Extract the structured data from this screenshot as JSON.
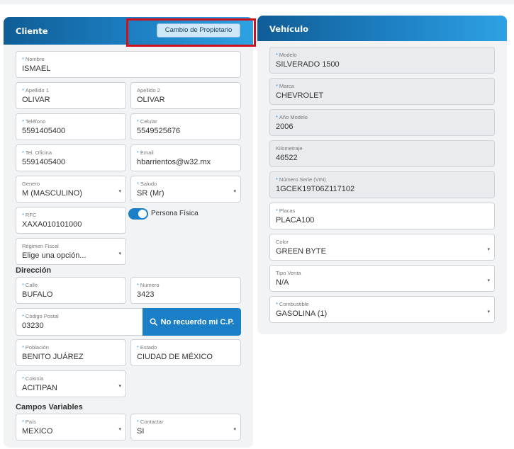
{
  "cliente": {
    "title": "Cliente",
    "owner_button": "Cambio de Propietario",
    "nombre": {
      "label": "Nombre",
      "value": "ISMAEL"
    },
    "apellido1": {
      "label": "Apellido 1",
      "value": "OLIVAR"
    },
    "apellido2": {
      "label": "Apellido 2",
      "value": "OLIVAR"
    },
    "telefono": {
      "label": "Teléfono",
      "value": "5591405400"
    },
    "celular": {
      "label": "Celular",
      "value": "5549525676"
    },
    "tel_oficina": {
      "label": "Tel. Oficina",
      "value": "5591405400"
    },
    "email": {
      "label": "Email",
      "value": "hbarrientos@w32.mx"
    },
    "genero": {
      "label": "Genero",
      "value": "M (MASCULINO)"
    },
    "saludo": {
      "label": "Saludo",
      "value": "SR (Mr)"
    },
    "rfc": {
      "label": "RFC",
      "value": "XAXA010101000"
    },
    "persona_fisica": {
      "label": "Persona Física",
      "on": true
    },
    "regimen": {
      "label": "Régimen Fiscal",
      "value": "Elige una opción..."
    },
    "direccion_title": "Dirección",
    "calle": {
      "label": "Calle",
      "value": "BUFALO"
    },
    "numero": {
      "label": "Numero",
      "value": "3423"
    },
    "cp": {
      "label": "Código Postal",
      "value": "03230"
    },
    "cp_button": "No recuerdo mi C.P.",
    "poblacion": {
      "label": "Población",
      "value": "BENITO JUÁREZ"
    },
    "estado": {
      "label": "Estado",
      "value": "CIUDAD DE MÉXICO"
    },
    "colonia": {
      "label": "Colonia",
      "value": "ACITIPAN"
    },
    "campos_title": "Campos Variables",
    "pais": {
      "label": "País",
      "value": "MEXICO"
    },
    "contactar": {
      "label": "Contactar",
      "value": "SI"
    }
  },
  "vehiculo": {
    "title": "Vehículo",
    "modelo": {
      "label": "Modelo",
      "value": "SILVERADO 1500"
    },
    "marca": {
      "label": "Marca",
      "value": "CHEVROLET"
    },
    "anio": {
      "label": "Año Modelo",
      "value": "2006"
    },
    "kilometraje": {
      "label": "Kilometraje",
      "value": "46522"
    },
    "vin": {
      "label": "Número Serie (VIN)",
      "value": "1GCEK19T06Z117102"
    },
    "placas": {
      "label": "Placas",
      "value": "PLACA100"
    },
    "color": {
      "label": "Color",
      "value": "GREEN BYTE"
    },
    "tipo_venta": {
      "label": "Tipo Venta",
      "value": "N/A"
    },
    "combustible": {
      "label": "Combustible",
      "value": "GASOLINA (1)"
    }
  },
  "colors": {
    "header": "#1a7fc6",
    "highlight": "#d0111b",
    "required": "#2b8fd8"
  },
  "icons": {
    "cp_button": "search-icon",
    "select": "chevron-down-icon"
  }
}
